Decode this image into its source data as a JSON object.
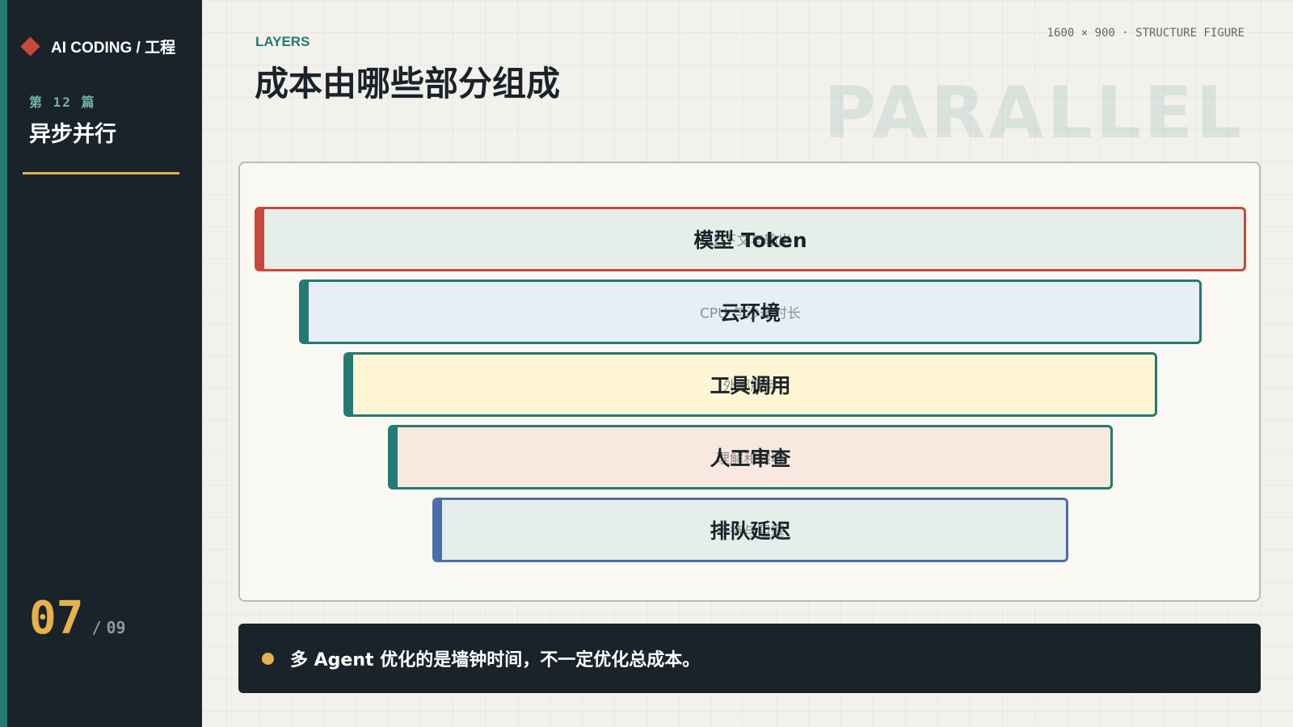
{
  "sidebar": {
    "brand": "AI CODING / 工程",
    "issue_label": "第 12 篇",
    "issue_title": "异步并行",
    "page_current": "07",
    "page_separator": "/",
    "page_total": "09"
  },
  "header": {
    "eyebrow": "LAYERS",
    "title": "成本由哪些部分组成",
    "meta": "1600 × 900 · STRUCTURE FIGURE",
    "watermark": "PARALLEL"
  },
  "layers": [
    {
      "name": "模型 Token",
      "desc": "上下文与输出",
      "border": "#c8483a",
      "fill": "#e6eeea"
    },
    {
      "name": "云环境",
      "desc": "CPU 与沙箱时长",
      "border": "#247a72",
      "fill": "#e7eef6"
    },
    {
      "name": "工具调用",
      "desc": "外部服务",
      "border": "#247a72",
      "fill": "#fdf5d4"
    },
    {
      "name": "人工审查",
      "desc": "理解和验收",
      "border": "#247a72",
      "fill": "#f8e8e0"
    },
    {
      "name": "排队延迟",
      "desc": "等待与阻塞",
      "border": "#4a6fa8",
      "fill": "#e6eeea"
    }
  ],
  "callout": {
    "text": "多 Agent 优化的是墙钟时间，不一定优化总成本。"
  },
  "colors": {
    "sidebar_bg": "#1a2329",
    "accent_teal": "#247a72",
    "accent_gold": "#e6b04a",
    "accent_red": "#c8483a"
  }
}
